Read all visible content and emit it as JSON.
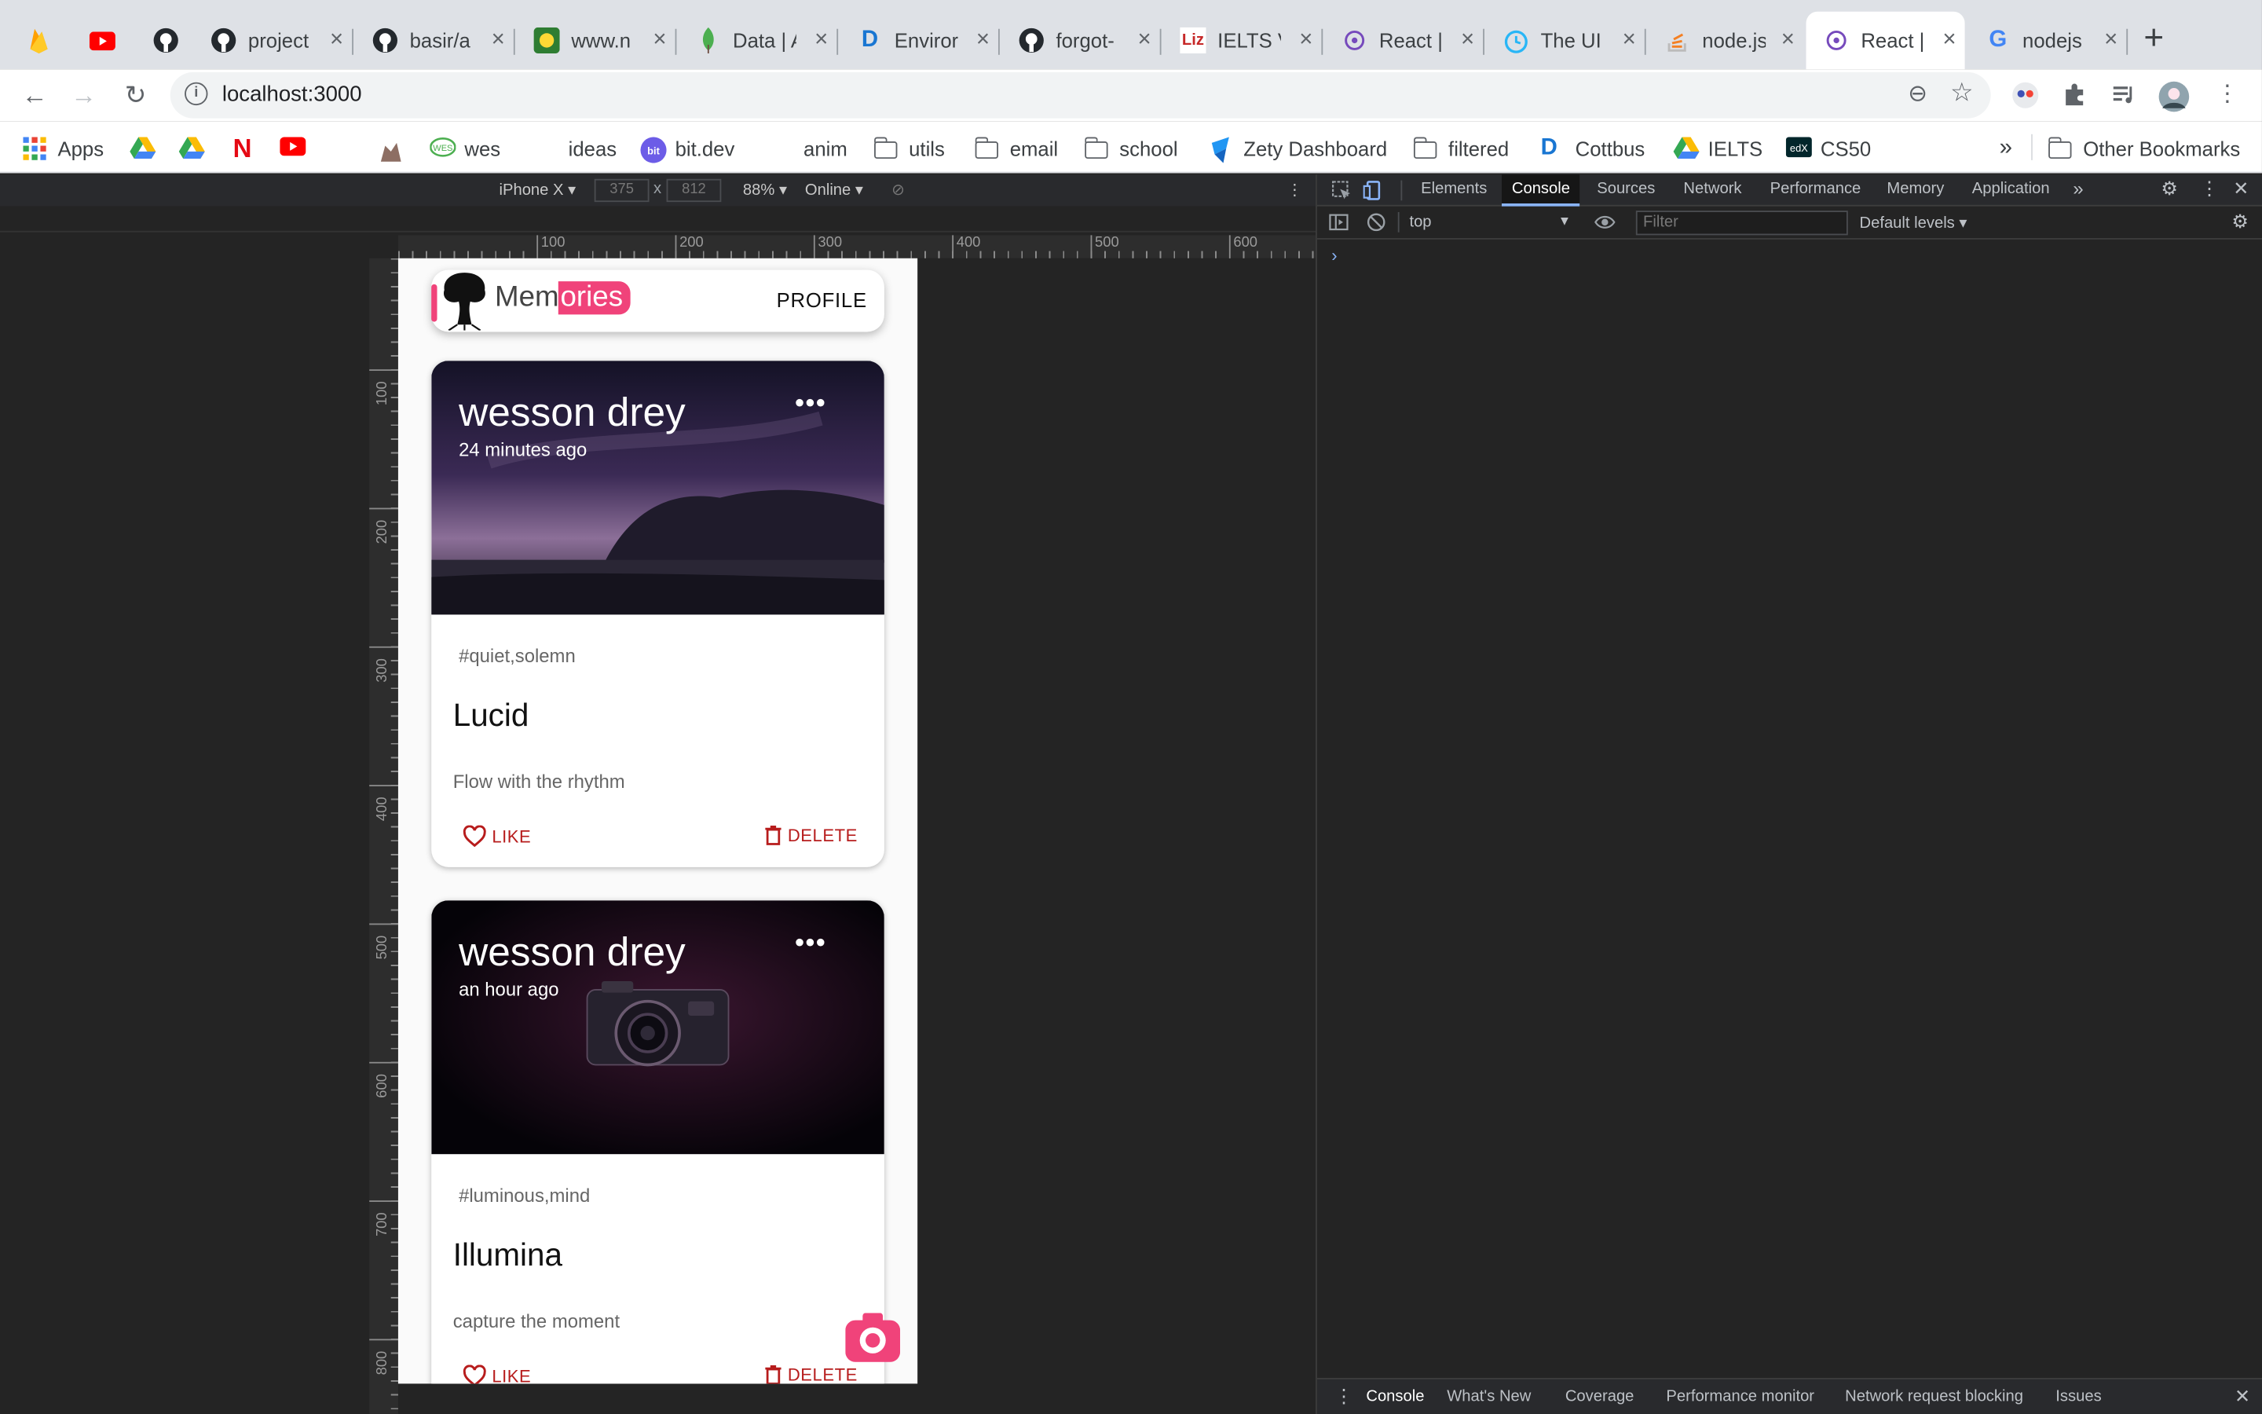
{
  "browser": {
    "tabs": [
      {
        "label": "",
        "icon": "firebase-icon",
        "color": "#f5a623"
      },
      {
        "label": "",
        "icon": "youtube-icon",
        "color": "#ff0000"
      },
      {
        "label": "",
        "icon": "github-icon",
        "color": "#24292e"
      },
      {
        "label": "project",
        "icon": "github-icon",
        "color": "#24292e"
      },
      {
        "label": "basir/a",
        "icon": "github-icon",
        "color": "#24292e"
      },
      {
        "label": "www.n",
        "icon": "site-icon",
        "color": "#2e7d32"
      },
      {
        "label": "Data | A",
        "icon": "mongodb-leaf-icon",
        "color": "#4caf50"
      },
      {
        "label": "Enviror",
        "icon": "d-icon",
        "color": "#1976d2"
      },
      {
        "label": "forgot-",
        "icon": "github-icon",
        "color": "#24292e"
      },
      {
        "label": "IELTS V",
        "icon": "liz-icon",
        "color": "#c62828"
      },
      {
        "label": "React |",
        "icon": "redux-icon",
        "color": "#764abc"
      },
      {
        "label": "The UI",
        "icon": "clock-icon",
        "color": "#29b6f6"
      },
      {
        "label": "node.js",
        "icon": "stackoverflow-icon",
        "color": "#f48024"
      },
      {
        "label": "React |",
        "icon": "redux-icon",
        "color": "#764abc",
        "active": true
      },
      {
        "label": "nodejs",
        "icon": "google-icon",
        "color": "#4285f4"
      }
    ],
    "url": "localhost:3000",
    "bookmarks": [
      {
        "label": "Apps",
        "icon": "apps-grid-icon"
      },
      {
        "label": "",
        "icon": "google-drive-icon"
      },
      {
        "label": "",
        "icon": "google-drive-icon"
      },
      {
        "label": "",
        "icon": "netflix-icon"
      },
      {
        "label": "",
        "icon": "youtube-icon"
      },
      {
        "label": "",
        "icon": "castle-icon"
      },
      {
        "label": "wes",
        "icon": "wes-icon"
      },
      {
        "label": "ideas",
        "icon": ""
      },
      {
        "label": "bit.dev",
        "icon": "bit-icon"
      },
      {
        "label": "anim",
        "icon": ""
      },
      {
        "label": "utils",
        "icon": "folder-icon"
      },
      {
        "label": "email",
        "icon": "folder-icon"
      },
      {
        "label": "school",
        "icon": "folder-icon"
      },
      {
        "label": "Zety Dashboard",
        "icon": "zety-icon"
      },
      {
        "label": "filtered",
        "icon": "folder-icon"
      },
      {
        "label": "Cottbus",
        "icon": "d-icon"
      },
      {
        "label": "IELTS",
        "icon": "google-drive-icon"
      },
      {
        "label": "CS50",
        "icon": "edx-icon"
      }
    ],
    "bookmarks_overflow": "»",
    "other_bookmarks": "Other Bookmarks"
  },
  "device_toolbar": {
    "device": "iPhone X",
    "width": "375",
    "height": "812",
    "times": "x",
    "zoom": "88%",
    "throttle": "Online",
    "ruler_ticks_h": [
      "100",
      "200",
      "300",
      "400",
      "500",
      "600"
    ],
    "ruler_ticks_v": [
      "100",
      "200",
      "300",
      "400",
      "500",
      "600",
      "700",
      "800"
    ]
  },
  "app": {
    "brand_prefix": "Mem",
    "brand_highlight": "ories",
    "profile_label": "PROFILE",
    "accent_color": "#f0437a",
    "posts": [
      {
        "creator": "wesson drey",
        "time": "24 minutes ago",
        "tags": "#quiet,solemn",
        "title": "Lucid",
        "message": "Flow with the rhythm",
        "like_label": "LIKE",
        "delete_label": "DELETE"
      },
      {
        "creator": "wesson drey",
        "time": "an hour ago",
        "tags": "#luminous,mind",
        "title": "Illumina",
        "message": "capture the moment",
        "like_label": "LIKE",
        "delete_label": "DELETE"
      }
    ]
  },
  "devtools": {
    "tabs": [
      "Elements",
      "Console",
      "Sources",
      "Network",
      "Performance",
      "Memory",
      "Application"
    ],
    "active_tab": "Console",
    "context": "top",
    "filter_placeholder": "Filter",
    "levels": "Default levels",
    "prompt": "›",
    "drawer_tabs": [
      "Console",
      "What's New",
      "Coverage",
      "Performance monitor",
      "Network request blocking",
      "Issues"
    ]
  }
}
